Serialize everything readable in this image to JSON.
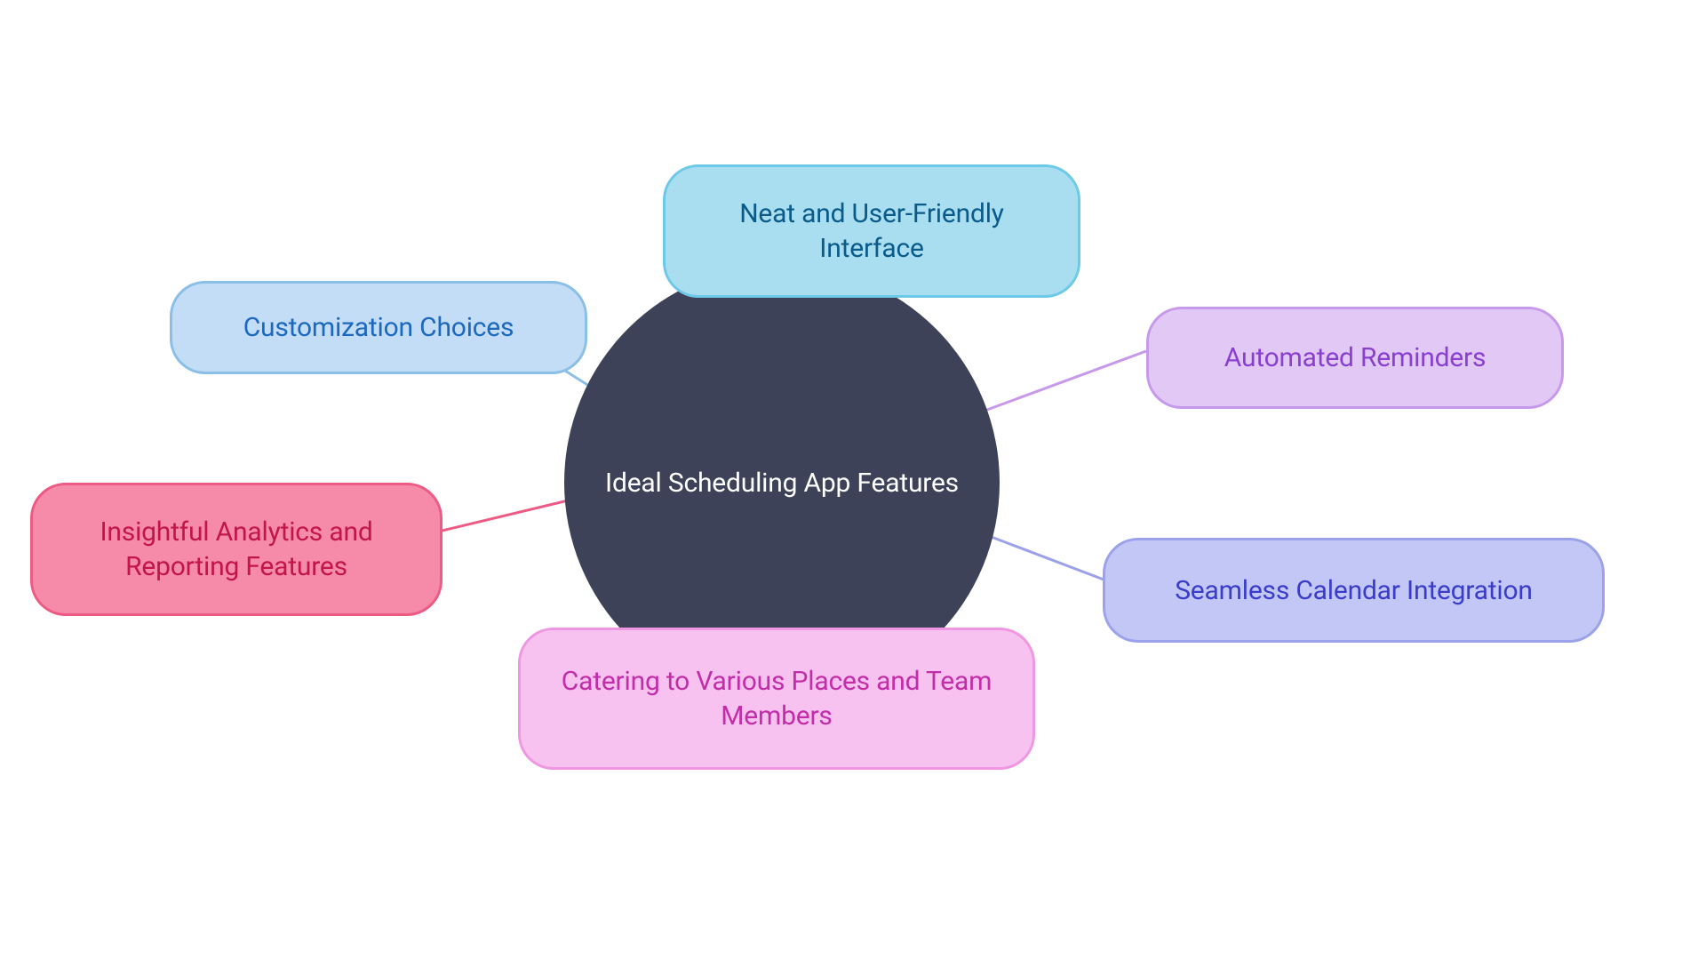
{
  "diagram": {
    "center": {
      "label": "Ideal Scheduling App Features",
      "bg": "#3d4258",
      "fg": "#ffffff"
    },
    "nodes": [
      {
        "id": "interface",
        "label": "Neat and User-Friendly Interface",
        "bg": "#a9def0",
        "border": "#6cc9e8",
        "fg": "#0a5a8a"
      },
      {
        "id": "reminders",
        "label": "Automated Reminders",
        "bg": "#e2c9f5",
        "border": "#c799ec",
        "fg": "#8a3fd1"
      },
      {
        "id": "calendar",
        "label": "Seamless Calendar Integration",
        "bg": "#c3c7f5",
        "border": "#9ba1ea",
        "fg": "#3a3dc9"
      },
      {
        "id": "catering",
        "label": "Catering to Various Places and Team Members",
        "bg": "#f7c2ef",
        "border": "#ef97e2",
        "fg": "#c22da8"
      },
      {
        "id": "analytics",
        "label": "Insightful Analytics and Reporting Features",
        "bg": "#f58ba8",
        "border": "#ed5a84",
        "fg": "#c2154c"
      },
      {
        "id": "customization",
        "label": "Customization Choices",
        "bg": "#c2ddf5",
        "border": "#8abfe8",
        "fg": "#1c68bf"
      }
    ]
  }
}
